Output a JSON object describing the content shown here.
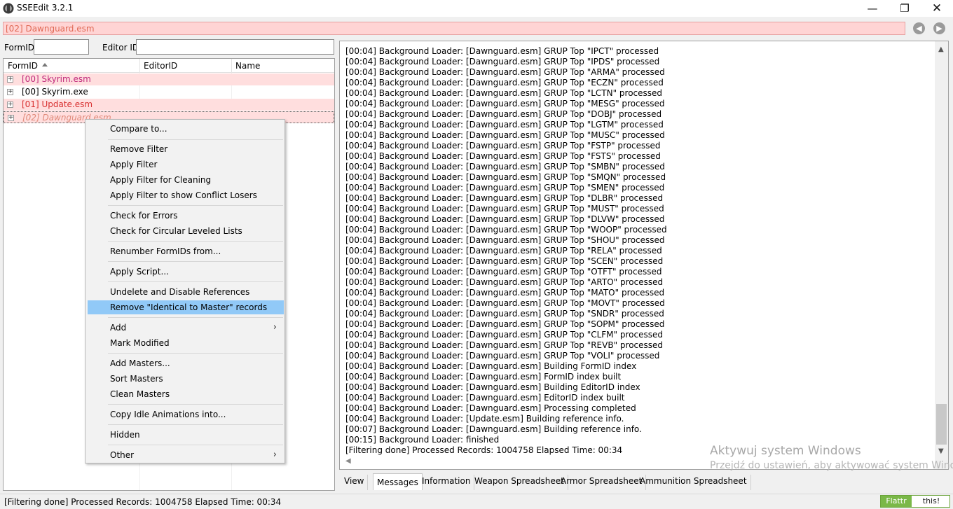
{
  "window": {
    "title": "SSEEdit 3.2.1",
    "minimize": "—",
    "maximize": "❐",
    "close": "✕"
  },
  "path_bar": {
    "text": "[02] Dawnguard.esm",
    "back": "◀",
    "forward": "▶"
  },
  "filter": {
    "formid_label": "FormID",
    "formid_value": "",
    "editorid_label": "Editor ID",
    "editorid_value": ""
  },
  "tree": {
    "columns": [
      "FormID",
      "EditorID",
      "Name"
    ],
    "rows": [
      {
        "name": "[00] Skyrim.esm",
        "expander": "+"
      },
      {
        "name": "[00] Skyrim.exe",
        "expander": "+"
      },
      {
        "name": "[01] Update.esm",
        "expander": "+"
      },
      {
        "name": "[02] Dawnguard.esm",
        "expander": "+"
      }
    ]
  },
  "context_menu": {
    "items": [
      "Compare to...",
      "Remove Filter",
      "Apply Filter",
      "Apply Filter for Cleaning",
      "Apply Filter to show Conflict Losers",
      "Check for Errors",
      "Check for Circular Leveled Lists",
      "Renumber FormIDs from...",
      "Apply Script...",
      "Undelete and Disable References",
      "Remove \"Identical to Master\" records",
      "Add",
      "Mark Modified",
      "Add Masters...",
      "Sort Masters",
      "Clean Masters",
      "Copy Idle Animations into...",
      "Hidden",
      "Other"
    ],
    "highlighted": "Remove \"Identical to Master\" records",
    "submenu_arrow": "›"
  },
  "log": {
    "lines": [
      "[00:04] Background Loader: [Dawnguard.esm] GRUP Top \"IPCT\" processed",
      "[00:04] Background Loader: [Dawnguard.esm] GRUP Top \"IPDS\" processed",
      "[00:04] Background Loader: [Dawnguard.esm] GRUP Top \"ARMA\" processed",
      "[00:04] Background Loader: [Dawnguard.esm] GRUP Top \"ECZN\" processed",
      "[00:04] Background Loader: [Dawnguard.esm] GRUP Top \"LCTN\" processed",
      "[00:04] Background Loader: [Dawnguard.esm] GRUP Top \"MESG\" processed",
      "[00:04] Background Loader: [Dawnguard.esm] GRUP Top \"DOBJ\" processed",
      "[00:04] Background Loader: [Dawnguard.esm] GRUP Top \"LGTM\" processed",
      "[00:04] Background Loader: [Dawnguard.esm] GRUP Top \"MUSC\" processed",
      "[00:04] Background Loader: [Dawnguard.esm] GRUP Top \"FSTP\" processed",
      "[00:04] Background Loader: [Dawnguard.esm] GRUP Top \"FSTS\" processed",
      "[00:04] Background Loader: [Dawnguard.esm] GRUP Top \"SMBN\" processed",
      "[00:04] Background Loader: [Dawnguard.esm] GRUP Top \"SMQN\" processed",
      "[00:04] Background Loader: [Dawnguard.esm] GRUP Top \"SMEN\" processed",
      "[00:04] Background Loader: [Dawnguard.esm] GRUP Top \"DLBR\" processed",
      "[00:04] Background Loader: [Dawnguard.esm] GRUP Top \"MUST\" processed",
      "[00:04] Background Loader: [Dawnguard.esm] GRUP Top \"DLVW\" processed",
      "[00:04] Background Loader: [Dawnguard.esm] GRUP Top \"WOOP\" processed",
      "[00:04] Background Loader: [Dawnguard.esm] GRUP Top \"SHOU\" processed",
      "[00:04] Background Loader: [Dawnguard.esm] GRUP Top \"RELA\" processed",
      "[00:04] Background Loader: [Dawnguard.esm] GRUP Top \"SCEN\" processed",
      "[00:04] Background Loader: [Dawnguard.esm] GRUP Top \"OTFT\" processed",
      "[00:04] Background Loader: [Dawnguard.esm] GRUP Top \"ARTO\" processed",
      "[00:04] Background Loader: [Dawnguard.esm] GRUP Top \"MATO\" processed",
      "[00:04] Background Loader: [Dawnguard.esm] GRUP Top \"MOVT\" processed",
      "[00:04] Background Loader: [Dawnguard.esm] GRUP Top \"SNDR\" processed",
      "[00:04] Background Loader: [Dawnguard.esm] GRUP Top \"SOPM\" processed",
      "[00:04] Background Loader: [Dawnguard.esm] GRUP Top \"CLFM\" processed",
      "[00:04] Background Loader: [Dawnguard.esm] GRUP Top \"REVB\" processed",
      "[00:04] Background Loader: [Dawnguard.esm] GRUP Top \"VOLI\" processed",
      "[00:04] Background Loader: [Dawnguard.esm] Building FormID index",
      "[00:04] Background Loader: [Dawnguard.esm] FormID index built",
      "[00:04] Background Loader: [Dawnguard.esm] Building EditorID index",
      "[00:04] Background Loader: [Dawnguard.esm] EditorID index built",
      "[00:04] Background Loader: [Dawnguard.esm] Processing completed",
      "[00:04] Background Loader: [Update.esm] Building reference info.",
      "[00:07] Background Loader: [Dawnguard.esm] Building reference info.",
      "[00:15] Background Loader: finished",
      "[Filtering done]  Processed Records: 1004758 Elapsed Time: 00:34"
    ]
  },
  "tabs": [
    {
      "label": "View",
      "active": false
    },
    {
      "label": "Messages",
      "active": true
    },
    {
      "label": "Information",
      "active": false
    },
    {
      "label": "Weapon Spreadsheet",
      "active": false
    },
    {
      "label": "Armor Spreadsheet",
      "active": false
    },
    {
      "label": "Ammunition Spreadsheet",
      "active": false
    }
  ],
  "watermark": {
    "title": "Aktywuj system Windows",
    "subtitle": "Przejdź do ustawień, aby aktywować system Windows."
  },
  "status_bar": {
    "text": "[Filtering done]  Processed Records: 1004758 Elapsed Time: 00:34"
  },
  "flattr": {
    "left": "Flattr",
    "right": "this!"
  },
  "colors": {
    "file_pink": "#ffdede",
    "skyrim_esm_text": "#c0287a",
    "update_esm_text": "#d83030",
    "menu_highlight": "#91c9f7"
  }
}
